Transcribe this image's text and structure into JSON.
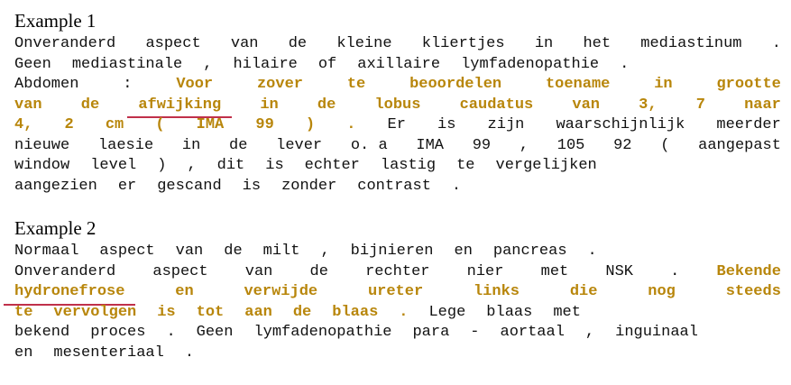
{
  "examples": [
    {
      "title": "Example 1",
      "lines": [
        {
          "align": "justify",
          "tokens": [
            {
              "t": "Onveranderd",
              "s": "n"
            },
            {
              "t": "aspect",
              "s": "n"
            },
            {
              "t": "van",
              "s": "n"
            },
            {
              "t": "de",
              "s": "n"
            },
            {
              "t": "kleine",
              "s": "n"
            },
            {
              "t": "kliertjes",
              "s": "n"
            },
            {
              "t": "in",
              "s": "n"
            },
            {
              "t": "het",
              "s": "n"
            },
            {
              "t": "mediastinum",
              "s": "n"
            },
            {
              "t": ".",
              "s": "n"
            }
          ]
        },
        {
          "align": "left",
          "tokens": [
            {
              "t": "Geen",
              "s": "n"
            },
            {
              "t": "mediastinale",
              "s": "n"
            },
            {
              "t": ",",
              "s": "n"
            },
            {
              "t": "hilaire",
              "s": "n"
            },
            {
              "t": "of",
              "s": "n"
            },
            {
              "t": "axillaire",
              "s": "n"
            },
            {
              "t": "lymfadenopathie",
              "s": "n"
            },
            {
              "t": ".",
              "s": "n"
            }
          ]
        },
        {
          "align": "justify",
          "tokens": [
            {
              "t": "Abdomen",
              "s": "n"
            },
            {
              "t": ":",
              "s": "n"
            },
            {
              "t": "Voor",
              "s": "h"
            },
            {
              "t": "zover",
              "s": "h"
            },
            {
              "t": "te",
              "s": "h"
            },
            {
              "t": "beoordelen",
              "s": "h"
            },
            {
              "t": "toename",
              "s": "h"
            },
            {
              "t": "in",
              "s": "h"
            },
            {
              "t": "grootte",
              "s": "h"
            }
          ]
        },
        {
          "align": "justify",
          "tokens": [
            {
              "t": "van",
              "s": "h"
            },
            {
              "t": "de",
              "s": "h"
            },
            {
              "t": "afwijking",
              "s": "u"
            },
            {
              "t": "in",
              "s": "h"
            },
            {
              "t": "de",
              "s": "h"
            },
            {
              "t": "lobus",
              "s": "h"
            },
            {
              "t": "caudatus",
              "s": "h"
            },
            {
              "t": "van",
              "s": "h"
            },
            {
              "t": "3,",
              "s": "h"
            },
            {
              "t": "7",
              "s": "h"
            },
            {
              "t": "naar",
              "s": "h"
            }
          ]
        },
        {
          "align": "justify",
          "tokens": [
            {
              "t": "4,",
              "s": "h"
            },
            {
              "t": "2",
              "s": "h"
            },
            {
              "t": "cm",
              "s": "h"
            },
            {
              "t": "(",
              "s": "h"
            },
            {
              "t": "IMA",
              "s": "h"
            },
            {
              "t": "99",
              "s": "h"
            },
            {
              "t": ")",
              "s": "h"
            },
            {
              "t": ".",
              "s": "h"
            },
            {
              "t": "Er",
              "s": "n"
            },
            {
              "t": "is",
              "s": "n"
            },
            {
              "t": "zijn",
              "s": "n"
            },
            {
              "t": "waarschijnlijk",
              "s": "n"
            },
            {
              "t": "meerder",
              "s": "n"
            }
          ]
        },
        {
          "align": "justify",
          "tokens": [
            {
              "t": "nieuwe",
              "s": "n"
            },
            {
              "t": "laesie",
              "s": "n"
            },
            {
              "t": "in",
              "s": "n"
            },
            {
              "t": "de",
              "s": "n"
            },
            {
              "t": "lever",
              "s": "n"
            },
            {
              "t": "o. a",
              "s": "n"
            },
            {
              "t": "IMA",
              "s": "n"
            },
            {
              "t": "99",
              "s": "n"
            },
            {
              "t": ",",
              "s": "n"
            },
            {
              "t": "105",
              "s": "n"
            },
            {
              "t": "92",
              "s": "n"
            },
            {
              "t": "(",
              "s": "n"
            },
            {
              "t": "aangepast",
              "s": "n"
            }
          ]
        },
        {
          "align": "left",
          "tokens": [
            {
              "t": "window",
              "s": "n"
            },
            {
              "t": "level",
              "s": "n"
            },
            {
              "t": ")",
              "s": "n"
            },
            {
              "t": ",",
              "s": "n"
            },
            {
              "t": "dit",
              "s": "n"
            },
            {
              "t": "is",
              "s": "n"
            },
            {
              "t": "echter",
              "s": "n"
            },
            {
              "t": "lastig",
              "s": "n"
            },
            {
              "t": "te",
              "s": "n"
            },
            {
              "t": "vergelijken",
              "s": "n"
            }
          ]
        },
        {
          "align": "left",
          "tokens": [
            {
              "t": "aangezien",
              "s": "n"
            },
            {
              "t": "er",
              "s": "n"
            },
            {
              "t": "gescand",
              "s": "n"
            },
            {
              "t": "is",
              "s": "n"
            },
            {
              "t": "zonder",
              "s": "n"
            },
            {
              "t": "contrast",
              "s": "n"
            },
            {
              "t": ".",
              "s": "n"
            }
          ]
        }
      ]
    },
    {
      "title": "Example 2",
      "lines": [
        {
          "align": "left",
          "tokens": [
            {
              "t": "Normaal",
              "s": "n"
            },
            {
              "t": "aspect",
              "s": "n"
            },
            {
              "t": "van",
              "s": "n"
            },
            {
              "t": "de",
              "s": "n"
            },
            {
              "t": "milt",
              "s": "n"
            },
            {
              "t": ",",
              "s": "n"
            },
            {
              "t": "bijnieren",
              "s": "n"
            },
            {
              "t": "en",
              "s": "n"
            },
            {
              "t": "pancreas",
              "s": "n"
            },
            {
              "t": ".",
              "s": "n"
            }
          ]
        },
        {
          "align": "justify",
          "tokens": [
            {
              "t": "Onveranderd",
              "s": "n"
            },
            {
              "t": "aspect",
              "s": "n"
            },
            {
              "t": "van",
              "s": "n"
            },
            {
              "t": "de",
              "s": "n"
            },
            {
              "t": "rechter",
              "s": "n"
            },
            {
              "t": "nier",
              "s": "n"
            },
            {
              "t": "met",
              "s": "n"
            },
            {
              "t": "NSK",
              "s": "n"
            },
            {
              "t": ".",
              "s": "n"
            },
            {
              "t": "Bekende",
              "s": "h"
            }
          ]
        },
        {
          "align": "justify",
          "tokens": [
            {
              "t": "hydronefrose",
              "s": "u"
            },
            {
              "t": "en",
              "s": "h"
            },
            {
              "t": "verwijde",
              "s": "h"
            },
            {
              "t": "ureter",
              "s": "h"
            },
            {
              "t": "links",
              "s": "h"
            },
            {
              "t": "die",
              "s": "h"
            },
            {
              "t": "nog",
              "s": "h"
            },
            {
              "t": "steeds",
              "s": "h"
            }
          ],
          "trail": true
        },
        {
          "align": "left",
          "tokens": [
            {
              "t": "te",
              "s": "h"
            },
            {
              "t": "vervolgen",
              "s": "h"
            },
            {
              "t": "is",
              "s": "h"
            },
            {
              "t": "tot",
              "s": "h"
            },
            {
              "t": "aan",
              "s": "h"
            },
            {
              "t": "de",
              "s": "h"
            },
            {
              "t": "blaas",
              "s": "h"
            },
            {
              "t": ".",
              "s": "h"
            },
            {
              "t": "Lege",
              "s": "n"
            },
            {
              "t": "blaas",
              "s": "n"
            },
            {
              "t": "met",
              "s": "n"
            }
          ],
          "tail_uline": 0
        },
        {
          "align": "left",
          "tokens": [
            {
              "t": "bekend",
              "s": "n"
            },
            {
              "t": "proces",
              "s": "n"
            },
            {
              "t": ".",
              "s": "n"
            },
            {
              "t": "Geen",
              "s": "n"
            },
            {
              "t": "lymfadenopathie",
              "s": "n"
            },
            {
              "t": "para",
              "s": "n"
            },
            {
              "t": "-",
              "s": "n"
            },
            {
              "t": "aortaal",
              "s": "n"
            },
            {
              "t": ",",
              "s": "n"
            },
            {
              "t": "inguinaal",
              "s": "n"
            }
          ]
        },
        {
          "align": "left",
          "tokens": [
            {
              "t": "en",
              "s": "n"
            },
            {
              "t": "mesenteriaal",
              "s": "n"
            },
            {
              "t": ".",
              "s": "n"
            }
          ]
        }
      ]
    }
  ],
  "colors": {
    "highlight_text": "#b8860b",
    "underline": "#c0304a",
    "body_text": "#111111"
  }
}
